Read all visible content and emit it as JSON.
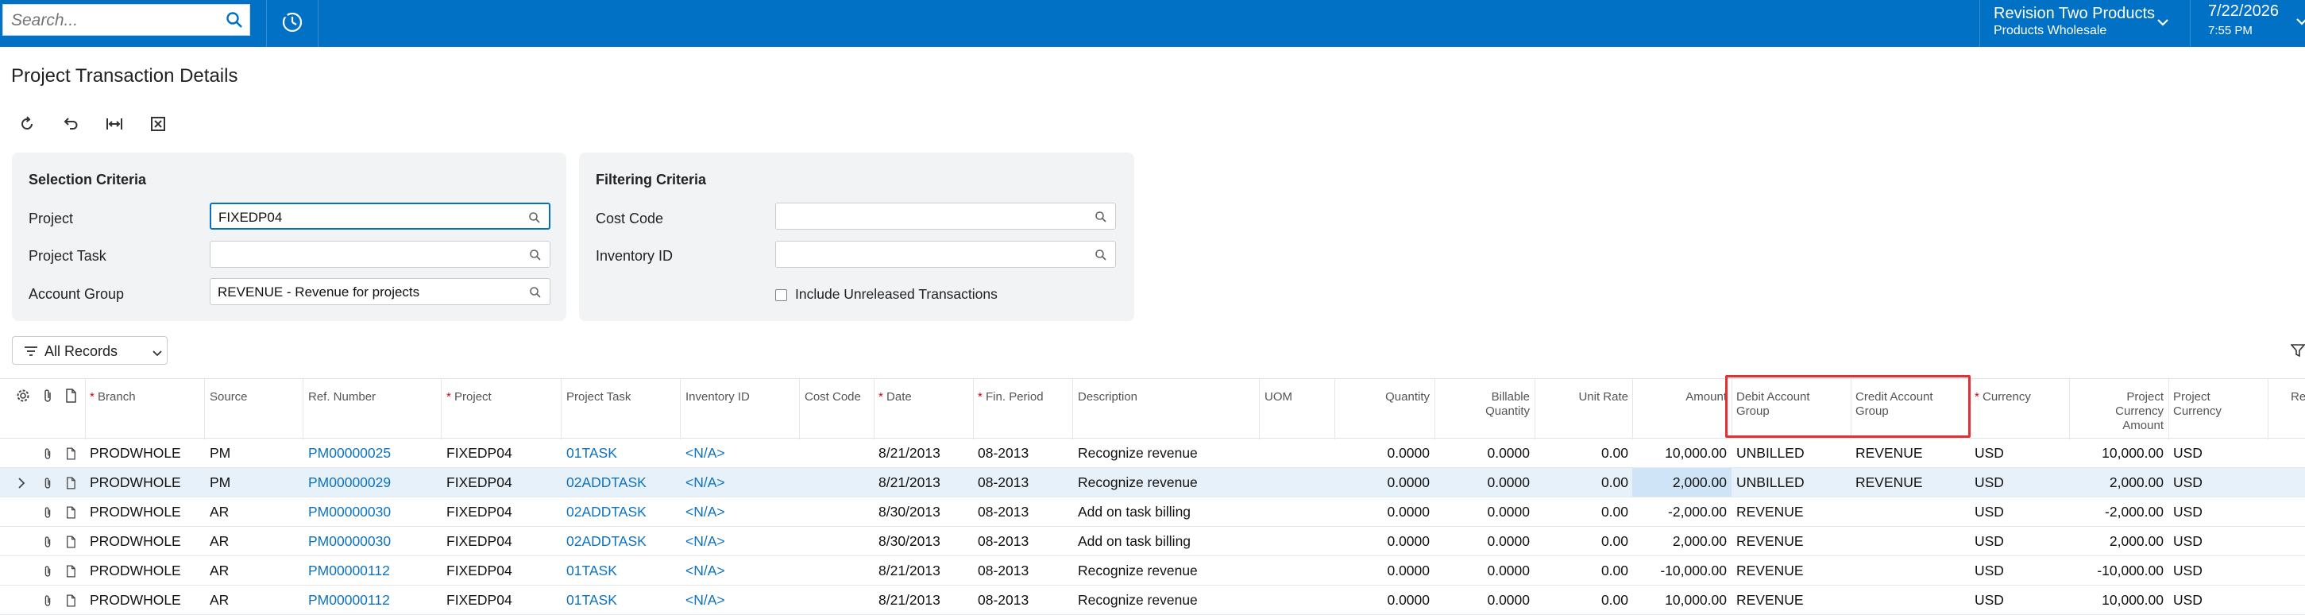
{
  "topbar": {
    "search_placeholder": "Search...",
    "company_name": "Revision Two Products",
    "company_branch": "Products Wholesale",
    "date": "7/22/2026",
    "time": "7:55 PM"
  },
  "page": {
    "title": "Project Transaction Details"
  },
  "selection": {
    "title": "Selection Criteria",
    "project_label": "Project",
    "project_value": "FIXEDP04",
    "task_label": "Project Task",
    "task_value": "",
    "group_label": "Account Group",
    "group_value": "REVENUE - Revenue for projects"
  },
  "filtering": {
    "title": "Filtering Criteria",
    "cost_code_label": "Cost Code",
    "cost_code_value": "",
    "inventory_label": "Inventory ID",
    "inventory_value": "",
    "unreleased_label": "Include Unreleased Transactions"
  },
  "records": {
    "label": "All Records"
  },
  "columns": {
    "branch": "Branch",
    "source": "Source",
    "ref": "Ref. Number",
    "project": "Project",
    "task": "Project Task",
    "inventory": "Inventory ID",
    "cost_code": "Cost Code",
    "date": "Date",
    "fin_period": "Fin. Period",
    "description": "Description",
    "uom": "UOM",
    "quantity": "Quantity",
    "billable_1": "Billable",
    "billable_2": "Quantity",
    "unit_rate": "Unit Rate",
    "amount": "Amount",
    "debit_1": "Debit Account",
    "debit_2": "Group",
    "credit_1": "Credit Account",
    "credit_2": "Group",
    "currency": "Currency",
    "pca_1": "Project",
    "pca_2": "Currency",
    "pca_3": "Amount",
    "pc_1": "Project",
    "pc_2": "Currency",
    "cut": "Re"
  },
  "rows": [
    {
      "branch": "PRODWHOLE",
      "source": "PM",
      "ref": "PM00000025",
      "project": "FIXEDP04",
      "task": "01TASK",
      "inventory": "<N/A>",
      "date": "8/21/2013",
      "period": "08-2013",
      "desc": "Recognize revenue",
      "qty": "0.0000",
      "bqty": "0.0000",
      "rate": "0.00",
      "amount": "10,000.00",
      "debit": "UNBILLED",
      "credit": "REVENUE",
      "currency": "USD",
      "pamount": "10,000.00",
      "pcur": "USD"
    },
    {
      "branch": "PRODWHOLE",
      "source": "PM",
      "ref": "PM00000029",
      "project": "FIXEDP04",
      "task": "02ADDTASK",
      "inventory": "<N/A>",
      "date": "8/21/2013",
      "period": "08-2013",
      "desc": "Recognize revenue",
      "qty": "0.0000",
      "bqty": "0.0000",
      "rate": "0.00",
      "amount": "2,000.00",
      "debit": "UNBILLED",
      "credit": "REVENUE",
      "currency": "USD",
      "pamount": "2,000.00",
      "pcur": "USD"
    },
    {
      "branch": "PRODWHOLE",
      "source": "AR",
      "ref": "PM00000030",
      "project": "FIXEDP04",
      "task": "02ADDTASK",
      "inventory": "<N/A>",
      "date": "8/30/2013",
      "period": "08-2013",
      "desc": "Add on task billing",
      "qty": "0.0000",
      "bqty": "0.0000",
      "rate": "0.00",
      "amount": "-2,000.00",
      "debit": "REVENUE",
      "credit": "",
      "currency": "USD",
      "pamount": "-2,000.00",
      "pcur": "USD"
    },
    {
      "branch": "PRODWHOLE",
      "source": "AR",
      "ref": "PM00000030",
      "project": "FIXEDP04",
      "task": "02ADDTASK",
      "inventory": "<N/A>",
      "date": "8/30/2013",
      "period": "08-2013",
      "desc": "Add on task billing",
      "qty": "0.0000",
      "bqty": "0.0000",
      "rate": "0.00",
      "amount": "2,000.00",
      "debit": "REVENUE",
      "credit": "",
      "currency": "USD",
      "pamount": "2,000.00",
      "pcur": "USD"
    },
    {
      "branch": "PRODWHOLE",
      "source": "AR",
      "ref": "PM00000112",
      "project": "FIXEDP04",
      "task": "01TASK",
      "inventory": "<N/A>",
      "date": "8/21/2013",
      "period": "08-2013",
      "desc": "Recognize revenue",
      "qty": "0.0000",
      "bqty": "0.0000",
      "rate": "0.00",
      "amount": "-10,000.00",
      "debit": "REVENUE",
      "credit": "",
      "currency": "USD",
      "pamount": "-10,000.00",
      "pcur": "USD"
    },
    {
      "branch": "PRODWHOLE",
      "source": "AR",
      "ref": "PM00000112",
      "project": "FIXEDP04",
      "task": "01TASK",
      "inventory": "<N/A>",
      "date": "8/21/2013",
      "period": "08-2013",
      "desc": "Recognize revenue",
      "qty": "0.0000",
      "bqty": "0.0000",
      "rate": "0.00",
      "amount": "10,000.00",
      "debit": "REVENUE",
      "credit": "",
      "currency": "USD",
      "pamount": "10,000.00",
      "pcur": "USD"
    }
  ]
}
